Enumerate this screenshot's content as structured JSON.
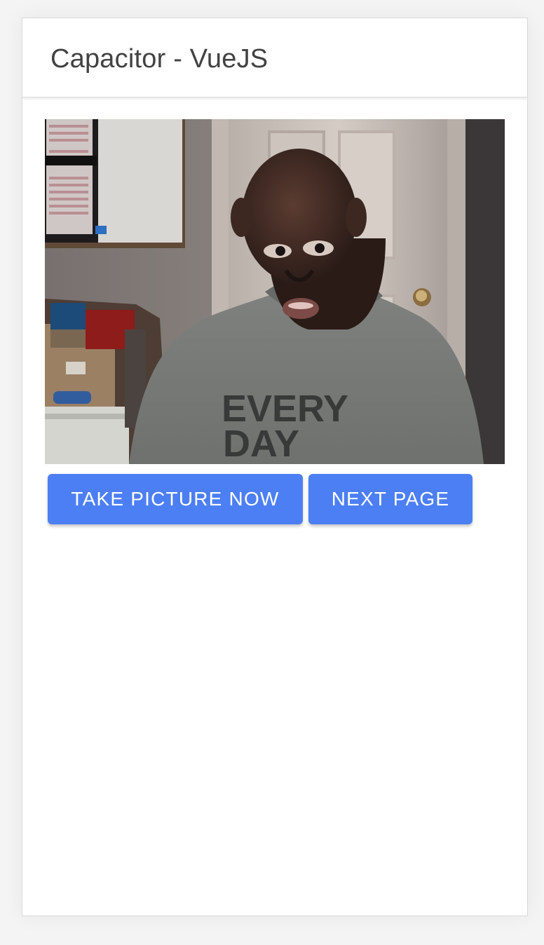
{
  "header": {
    "title": "Capacitor - VueJS"
  },
  "main": {
    "photo": {
      "description_icon": "camera-photo"
    },
    "buttons": {
      "take_picture": "TAKE PICTURE NOW",
      "next_page": "NEXT PAGE"
    }
  },
  "colors": {
    "accent": "#4c7ff3",
    "title_text": "#424242",
    "background": "#f4f4f4",
    "surface": "#ffffff"
  }
}
